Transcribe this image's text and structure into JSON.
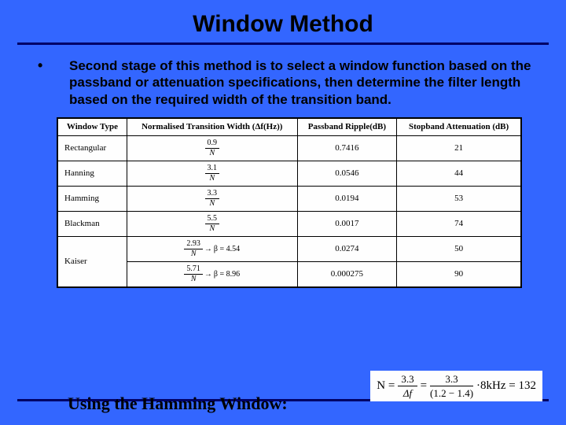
{
  "title": "Window Method",
  "bullet": "Second stage of this method is to select  a window function based on  the passband or attenuation specifications, then determine the filter length based on the required width of the transition band.",
  "table": {
    "headers": [
      "Window Type",
      "Normalised Transition Width (Δf(Hz))",
      "Passband Ripple(dB)",
      "Stopband Attenuation (dB)"
    ],
    "rows": [
      {
        "type": "Rectangular",
        "width_num": "0.9",
        "width_den": "N",
        "ripple": "0.7416",
        "atten": "21"
      },
      {
        "type": "Hanning",
        "width_num": "3.1",
        "width_den": "N",
        "ripple": "0.0546",
        "atten": "44"
      },
      {
        "type": "Hamming",
        "width_num": "3.3",
        "width_den": "N",
        "ripple": "0.0194",
        "atten": "53"
      },
      {
        "type": "Blackman",
        "width_num": "5.5",
        "width_den": "N",
        "ripple": "0.0017",
        "atten": "74"
      }
    ],
    "kaiser": {
      "type": "Kaiser",
      "line1_num": "2.93",
      "line1_den": "N",
      "line1_beta": "β = 4.54",
      "line2_num": "5.71",
      "line2_den": "N",
      "line2_beta": "β = 8.96",
      "ripple1": "0.0274",
      "atten1": "50",
      "ripple2": "0.000275",
      "atten2": "90"
    }
  },
  "bottom": {
    "label": "Using the Hamming Window:",
    "eq_lhs": "N =",
    "eq_f1_num": "3.3",
    "eq_f1_den": "Δf",
    "eq_mid": "=",
    "eq_f2_num": "3.3",
    "eq_f2_den": "(1.2 − 1.4)",
    "eq_suffix": "·8kHz = 132"
  }
}
